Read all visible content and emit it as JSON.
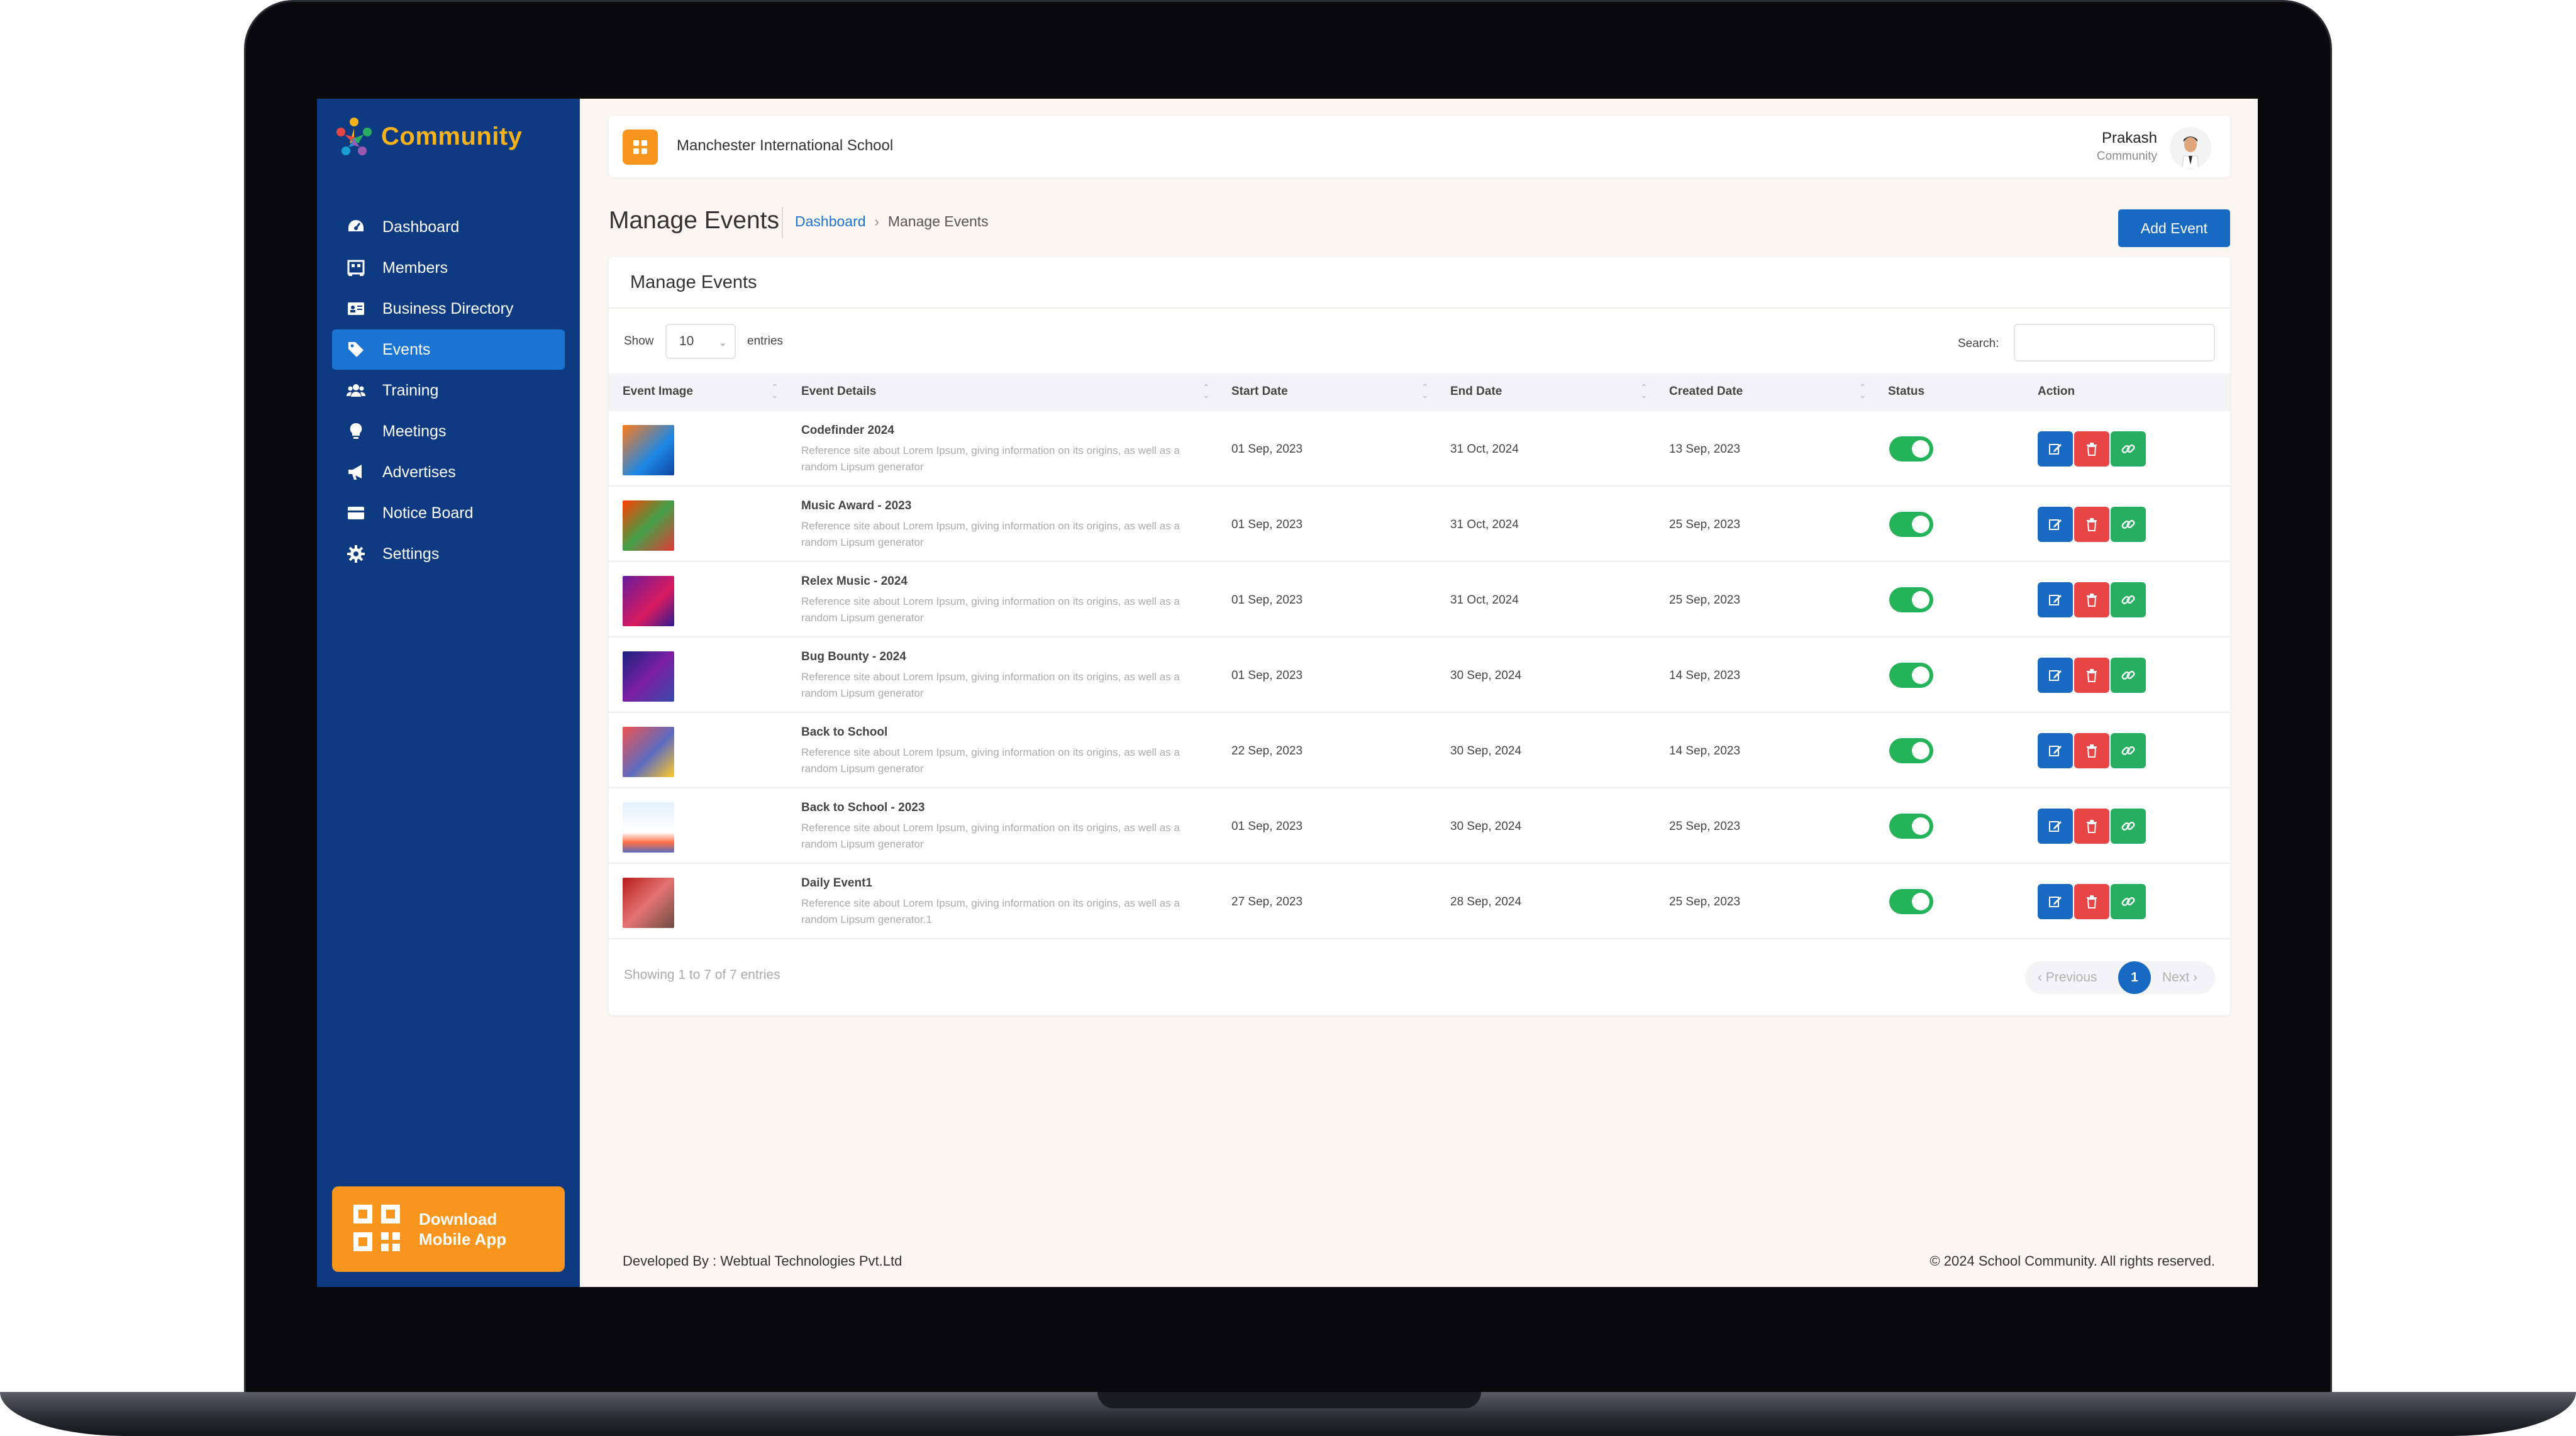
{
  "brand": {
    "name": "Community"
  },
  "sidebar": {
    "items": [
      {
        "label": "Dashboard",
        "icon": "dashboard-icon"
      },
      {
        "label": "Members",
        "icon": "members-icon"
      },
      {
        "label": "Business Directory",
        "icon": "directory-icon"
      },
      {
        "label": "Events",
        "icon": "tag-icon",
        "active": true
      },
      {
        "label": "Training",
        "icon": "users-icon"
      },
      {
        "label": "Meetings",
        "icon": "bulb-icon"
      },
      {
        "label": "Advertises",
        "icon": "megaphone-icon"
      },
      {
        "label": "Notice Board",
        "icon": "board-icon"
      },
      {
        "label": "Settings",
        "icon": "gear-icon"
      }
    ],
    "download": {
      "line1": "Download",
      "line2": "Mobile App"
    }
  },
  "header": {
    "school": "Manchester International School",
    "user_name": "Prakash",
    "user_role": "Community"
  },
  "page": {
    "title": "Manage Events",
    "breadcrumb": [
      "Dashboard",
      "Manage Events"
    ],
    "add_button": "Add Event"
  },
  "card": {
    "title": "Manage Events",
    "show_label": "Show",
    "entries_value": "10",
    "entries_label": "entries",
    "search_label": "Search:"
  },
  "table": {
    "columns": [
      "Event Image",
      "Event Details",
      "Start Date",
      "End Date",
      "Created Date",
      "Status",
      "Action"
    ],
    "rows": [
      {
        "title": "Codefinder 2024",
        "desc": "Reference site about Lorem Ipsum, giving information on its origins, as well as a random Lipsum generator",
        "start": "01 Sep, 2023",
        "end": "31 Oct, 2024",
        "created": "13 Sep, 2023",
        "status": true
      },
      {
        "title": "Music Award - 2023",
        "desc": "Reference site about Lorem Ipsum, giving information on its origins, as well as a random Lipsum generator",
        "start": "01 Sep, 2023",
        "end": "31 Oct, 2024",
        "created": "25 Sep, 2023",
        "status": true
      },
      {
        "title": "Relex Music - 2024",
        "desc": "Reference site about Lorem Ipsum, giving information on its origins, as well as a random Lipsum generator",
        "start": "01 Sep, 2023",
        "end": "31 Oct, 2024",
        "created": "25 Sep, 2023",
        "status": true
      },
      {
        "title": "Bug Bounty - 2024",
        "desc": "Reference site about Lorem Ipsum, giving information on its origins, as well as a random Lipsum generator",
        "start": "01 Sep, 2023",
        "end": "30 Sep, 2024",
        "created": "14 Sep, 2023",
        "status": true
      },
      {
        "title": "Back to School",
        "desc": "Reference site about Lorem Ipsum, giving information on its origins, as well as a random Lipsum generator",
        "start": "22 Sep, 2023",
        "end": "30 Sep, 2024",
        "created": "14 Sep, 2023",
        "status": true
      },
      {
        "title": "Back to School - 2023",
        "desc": "Reference site about Lorem Ipsum, giving information on its origins, as well as a random Lipsum generator",
        "start": "01 Sep, 2023",
        "end": "30 Sep, 2024",
        "created": "25 Sep, 2023",
        "status": true
      },
      {
        "title": "Daily Event1",
        "desc": "Reference site about Lorem Ipsum, giving information on its origins, as well as a random Lipsum generator.1",
        "start": "27 Sep, 2023",
        "end": "28 Sep, 2024",
        "created": "25 Sep, 2023",
        "status": true
      }
    ]
  },
  "pagination": {
    "info": "Showing 1 to 7 of 7 entries",
    "prev": "‹ Previous",
    "page": "1",
    "next": "Next ›"
  },
  "footer": {
    "left": "Developed By : Webtual Technologies Pvt.Ltd",
    "right": "© 2024 School Community. All rights reserved."
  },
  "colors": {
    "sidebar": "#0e3a82",
    "active": "#1b74d1",
    "accent": "#f8951d",
    "primary": "#1769c2",
    "danger": "#e84545",
    "success": "#27ae60"
  }
}
